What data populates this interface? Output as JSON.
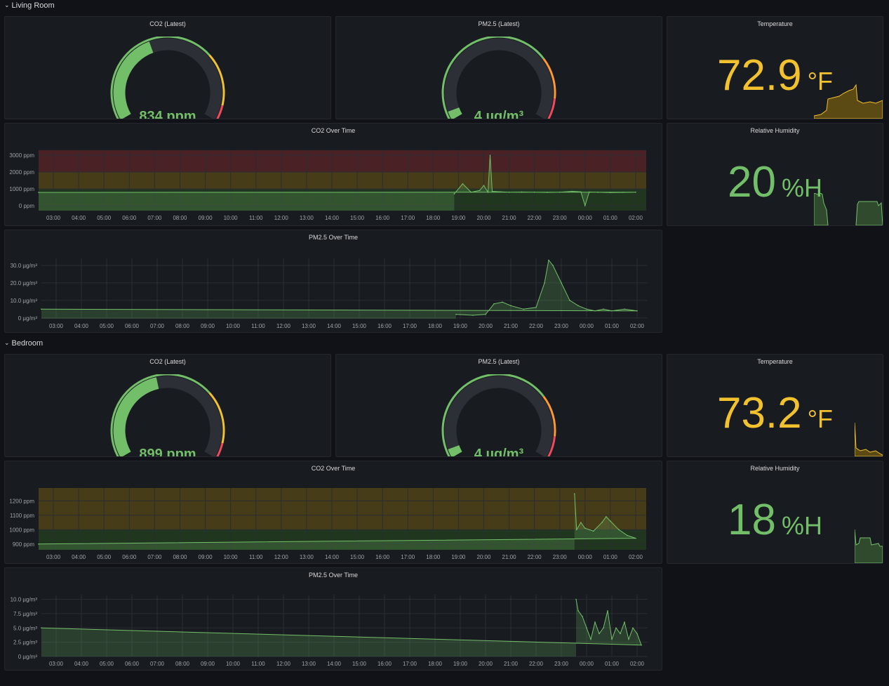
{
  "rows": [
    {
      "title": "Living Room",
      "co2_latest": {
        "title": "CO2 (Latest)",
        "display": "834 ppm",
        "value": 834,
        "min": 0,
        "max": 2000
      },
      "pm_latest": {
        "title": "PM2.5 (Latest)",
        "display": "4 µg/m³",
        "value": 4,
        "min": 0,
        "max": 100
      },
      "temperature": {
        "title": "Temperature",
        "value": "72.9",
        "unit": "°F",
        "color": "#f2c12e"
      },
      "humidity": {
        "title": "Relative Humidity",
        "value": "20",
        "unit": "%H",
        "color": "#73bf69"
      },
      "co2_series": {
        "title": "CO2 Over Time",
        "y_ticks": [
          "3000 ppm",
          "2000 ppm",
          "1000 ppm",
          "0 ppm"
        ]
      },
      "pm_series": {
        "title": "PM2.5 Over Time",
        "y_ticks": [
          "30.0 µg/m³",
          "20.0 µg/m³",
          "10.0 µg/m³",
          "0 µg/m³"
        ]
      }
    },
    {
      "title": "Bedroom",
      "co2_latest": {
        "title": "CO2 (Latest)",
        "display": "899 ppm",
        "value": 899,
        "min": 0,
        "max": 2000
      },
      "pm_latest": {
        "title": "PM2.5 (Latest)",
        "display": "4 µg/m³",
        "value": 4,
        "min": 0,
        "max": 100
      },
      "temperature": {
        "title": "Temperature",
        "value": "73.2",
        "unit": "°F",
        "color": "#f2c12e"
      },
      "humidity": {
        "title": "Relative Humidity",
        "value": "18",
        "unit": "%H",
        "color": "#73bf69"
      },
      "co2_series": {
        "title": "CO2 Over Time",
        "y_ticks": [
          "1200 ppm",
          "1100 ppm",
          "1000 ppm",
          "900 ppm"
        ]
      },
      "pm_series": {
        "title": "PM2.5 Over Time",
        "y_ticks": [
          "10.0 µg/m³",
          "7.5 µg/m³",
          "5.0 µg/m³",
          "2.5 µg/m³",
          "0 µg/m³"
        ]
      }
    }
  ],
  "x_ticks": [
    "03:00",
    "04:00",
    "05:00",
    "06:00",
    "07:00",
    "08:00",
    "09:00",
    "10:00",
    "11:00",
    "12:00",
    "13:00",
    "14:00",
    "15:00",
    "16:00",
    "17:00",
    "18:00",
    "19:00",
    "20:00",
    "21:00",
    "22:00",
    "23:00",
    "00:00",
    "01:00",
    "02:00"
  ],
  "colors": {
    "green": "#73bf69",
    "yellow": "#f2c12e",
    "orange": "#ff9830",
    "red": "#f2495c",
    "panel": "#181b1f",
    "track": "#2c2f36"
  },
  "chart_data": [
    {
      "type": "line",
      "title": "CO2 Over Time",
      "panel": "Living Room",
      "ylim": [
        -300,
        3300
      ],
      "x": [
        "18:50",
        "19:10",
        "19:30",
        "19:50",
        "20:00",
        "20:10",
        "20:15",
        "20:20",
        "20:40",
        "21:00",
        "21:30",
        "22:00",
        "22:30",
        "23:00",
        "23:30",
        "23:50",
        "00:00",
        "00:10",
        "00:30",
        "01:00",
        "01:30",
        "02:00",
        "02:25"
      ],
      "values": [
        700,
        1300,
        800,
        900,
        1200,
        800,
        3000,
        850,
        820,
        800,
        810,
        800,
        790,
        800,
        850,
        820,
        0,
        810,
        800,
        780,
        790,
        800,
        790
      ]
    },
    {
      "type": "area",
      "title": "PM2.5 Over Time",
      "panel": "Living Room",
      "ylim": [
        -0.5,
        34
      ],
      "x": [
        "18:50",
        "19:30",
        "20:00",
        "20:20",
        "20:40",
        "21:00",
        "21:30",
        "22:00",
        "22:20",
        "22:30",
        "22:40",
        "23:00",
        "23:20",
        "23:40",
        "00:00",
        "00:20",
        "00:40",
        "01:00",
        "01:30",
        "02:00",
        "02:25"
      ],
      "values": [
        2,
        1.5,
        2,
        8,
        9,
        7,
        5,
        6,
        20,
        33,
        30,
        20,
        10,
        7,
        5,
        4,
        5,
        4,
        5,
        4,
        5
      ]
    },
    {
      "type": "line",
      "title": "CO2 Over Time",
      "panel": "Bedroom",
      "ylim": [
        860,
        1290
      ],
      "x": [
        "23:35",
        "23:40",
        "23:50",
        "00:00",
        "00:20",
        "00:40",
        "00:50",
        "01:00",
        "01:20",
        "01:40",
        "02:00",
        "02:25"
      ],
      "values": [
        1250,
        1000,
        1050,
        1010,
        990,
        1050,
        1090,
        1060,
        1000,
        960,
        940,
        900
      ]
    },
    {
      "type": "area",
      "title": "PM2.5 Over Time",
      "panel": "Bedroom",
      "ylim": [
        0,
        10.8
      ],
      "x": [
        "23:35",
        "23:40",
        "23:50",
        "00:00",
        "00:10",
        "00:20",
        "00:30",
        "00:40",
        "00:50",
        "01:00",
        "01:10",
        "01:20",
        "01:30",
        "01:40",
        "01:50",
        "02:00",
        "02:10",
        "02:25"
      ],
      "values": [
        10,
        8,
        7,
        5,
        3,
        6,
        4,
        5,
        8,
        3,
        5,
        4,
        6,
        3,
        5,
        4,
        2,
        5
      ]
    }
  ]
}
